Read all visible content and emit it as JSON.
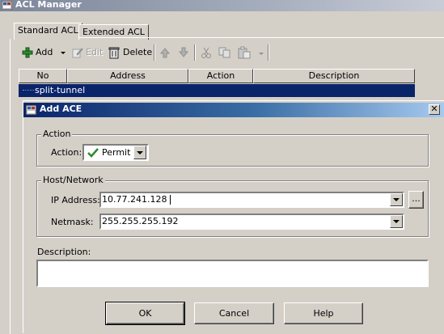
{
  "parent_window": {
    "title": "ACL Manager"
  },
  "tabs": [
    {
      "label": "Standard ACL",
      "selected": true
    },
    {
      "label": "Extended ACL",
      "selected": false
    }
  ],
  "toolbar": {
    "add_label": "Add",
    "edit_label": "Edit",
    "delete_label": "Delete"
  },
  "table": {
    "columns": [
      "No",
      "Address",
      "Action",
      "Description"
    ],
    "rows": [
      {
        "label": "split-tunnel",
        "selected": true
      }
    ]
  },
  "dialog": {
    "title": "Add ACE",
    "close_symbol": "✕",
    "action_group": {
      "legend": "Action",
      "label": "Action:",
      "value": "Permit"
    },
    "host_group": {
      "legend": "Host/Network",
      "ip_label": "IP Address:",
      "ip_value": "10.77.241.128",
      "browse_label": "...",
      "netmask_label": "Netmask:",
      "netmask_value": "255.255.255.192"
    },
    "description": {
      "label": "Description:",
      "value": ""
    },
    "buttons": {
      "ok": "OK",
      "cancel": "Cancel",
      "help": "Help"
    }
  },
  "colors": {
    "selection": "#0a246a",
    "dialog_title_start": "#0a246a",
    "dialog_title_end": "#a6caf0",
    "face": "#d4d0c8",
    "permit_check": "#2e8b2e"
  }
}
